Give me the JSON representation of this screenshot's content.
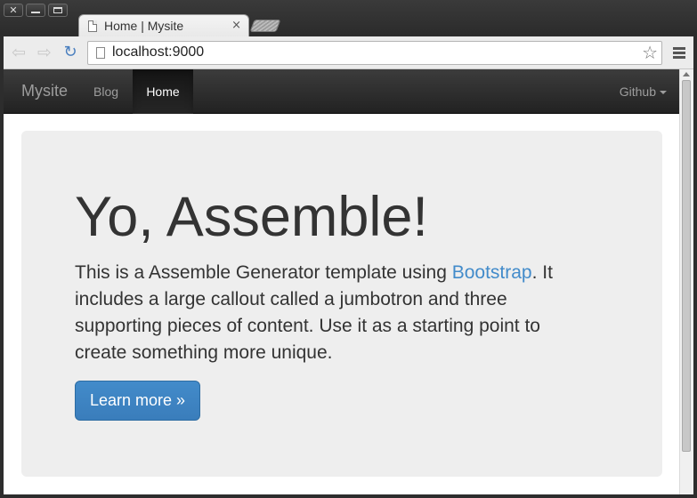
{
  "browser": {
    "window_controls": {
      "close": "✕"
    },
    "tab": {
      "title": "Home | Mysite",
      "close": "×"
    },
    "toolbar": {
      "back": "⇦",
      "forward": "⇨",
      "reload": "↻",
      "url": "localhost:9000",
      "bookmark_star": "☆"
    }
  },
  "navbar": {
    "brand": "Mysite",
    "items": [
      {
        "label": "Blog",
        "active": false
      },
      {
        "label": "Home",
        "active": true
      }
    ],
    "dropdown": {
      "label": "Github"
    }
  },
  "jumbotron": {
    "title": "Yo, Assemble!",
    "text_before_link": "This is a Assemble Generator template using ",
    "link": "Bootstrap",
    "text_after_link": ". It includes a large callout called a jumbotron and three supporting pieces of content. Use it as a starting point to create something more unique.",
    "button": "Learn more »"
  },
  "colors": {
    "accent": "#428bca",
    "navbar_bg": "#222222",
    "jumbotron_bg": "#eeeeee"
  }
}
